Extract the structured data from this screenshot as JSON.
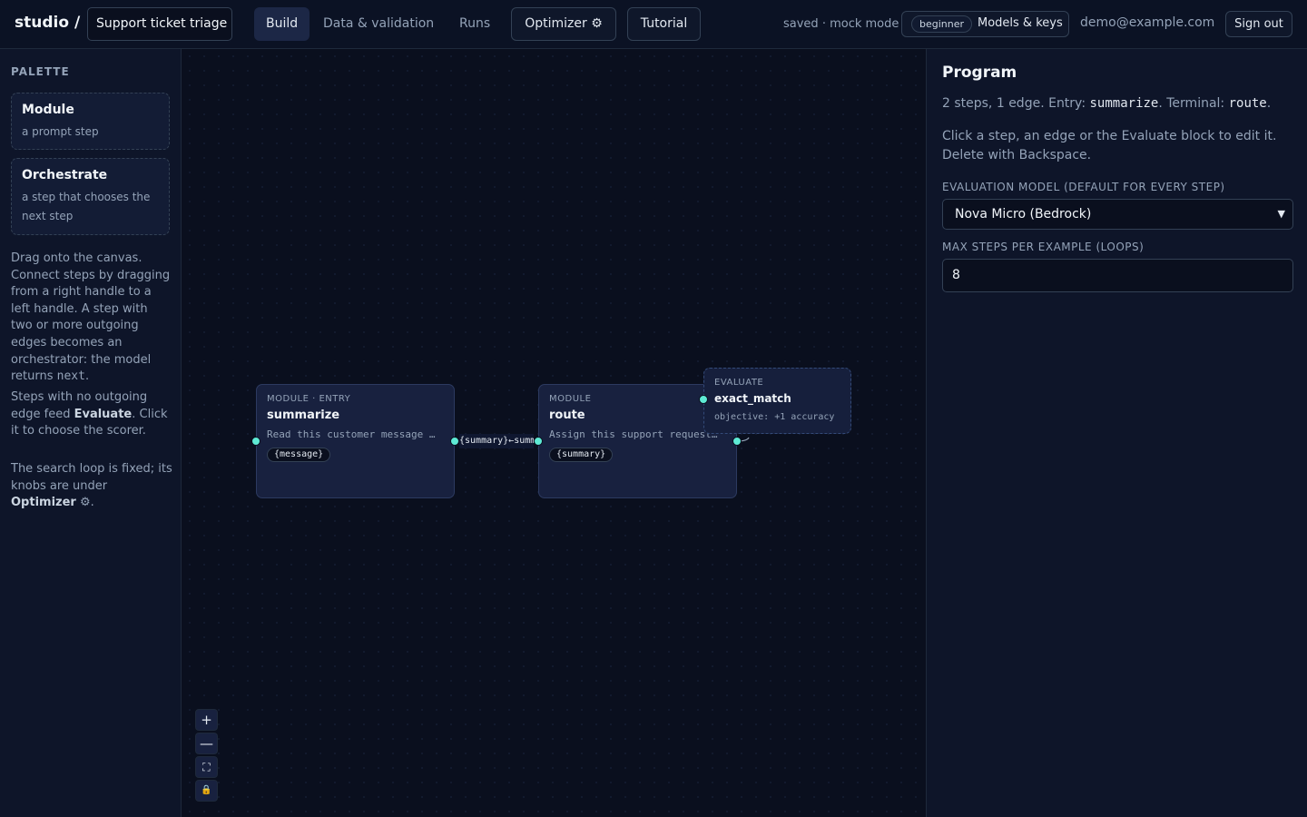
{
  "header": {
    "brand": "studio /",
    "project_name": "Support ticket triage",
    "tabs": [
      {
        "label": "Build"
      },
      {
        "label": "Data & validation"
      },
      {
        "label": "Runs"
      }
    ],
    "optimizer_label": "Optimizer ⚙",
    "tutorial_label": "Tutorial",
    "status": "saved · mock mode",
    "level_badge": "beginner",
    "models_label": "Models & keys",
    "user_email": "demo@example.com",
    "signout_label": "Sign out"
  },
  "palette": {
    "title": "PALETTE",
    "items": [
      {
        "title": "Module",
        "desc": "a prompt step"
      },
      {
        "title": "Orchestrate",
        "desc": "a step that chooses the next step"
      }
    ],
    "help1_a": "Drag onto the canvas. Connect steps by dragging from a right handle to a left handle. A step with two or more outgoing edges becomes an orchestrator: the model returns ",
    "help1_code": "next",
    "help1_b": ".",
    "help2_a": "Steps with no outgoing edge feed ",
    "help2_bold": "Evaluate",
    "help2_b": ". Click it to choose the scorer.",
    "help3_a": "The search loop is fixed; its knobs are under ",
    "help3_bold": "Optimizer",
    "help3_icon": "⚙",
    "help3_b": "."
  },
  "canvas": {
    "nodes": [
      {
        "kind": "MODULE · ENTRY",
        "name": "summarize",
        "prompt": "Read this customer message and summarize it",
        "input": "{message}"
      },
      {
        "kind": "MODULE",
        "name": "route",
        "prompt": "Assign this support request to a team",
        "input": "{summary}"
      }
    ],
    "edge_label": "{summary}←summary",
    "evaluate": {
      "kind": "EVALUATE",
      "name": "exact_match",
      "objective": "objective: +1 accuracy"
    },
    "controls": {
      "zoom_in": "+",
      "zoom_out": "—",
      "fit": "⛶",
      "lock": "🔒"
    }
  },
  "program": {
    "title": "Program",
    "summary_a": "2 steps, 1 edge. Entry: ",
    "entry": "summarize",
    "summary_b": ". Terminal: ",
    "terminal": "route",
    "summary_c": ".",
    "help": "Click a step, an edge or the Evaluate block to edit it. Delete with Backspace.",
    "eval_model_label": "EVALUATION MODEL (DEFAULT FOR EVERY STEP)",
    "eval_model_value": "Nova Micro (Bedrock)",
    "max_steps_label": "MAX STEPS PER EXAMPLE (LOOPS)",
    "max_steps_value": "8"
  },
  "colors": {
    "accent": "#5eead4",
    "background": "#0a0f1e",
    "panel": "#0e1529",
    "node": "#18213f"
  }
}
